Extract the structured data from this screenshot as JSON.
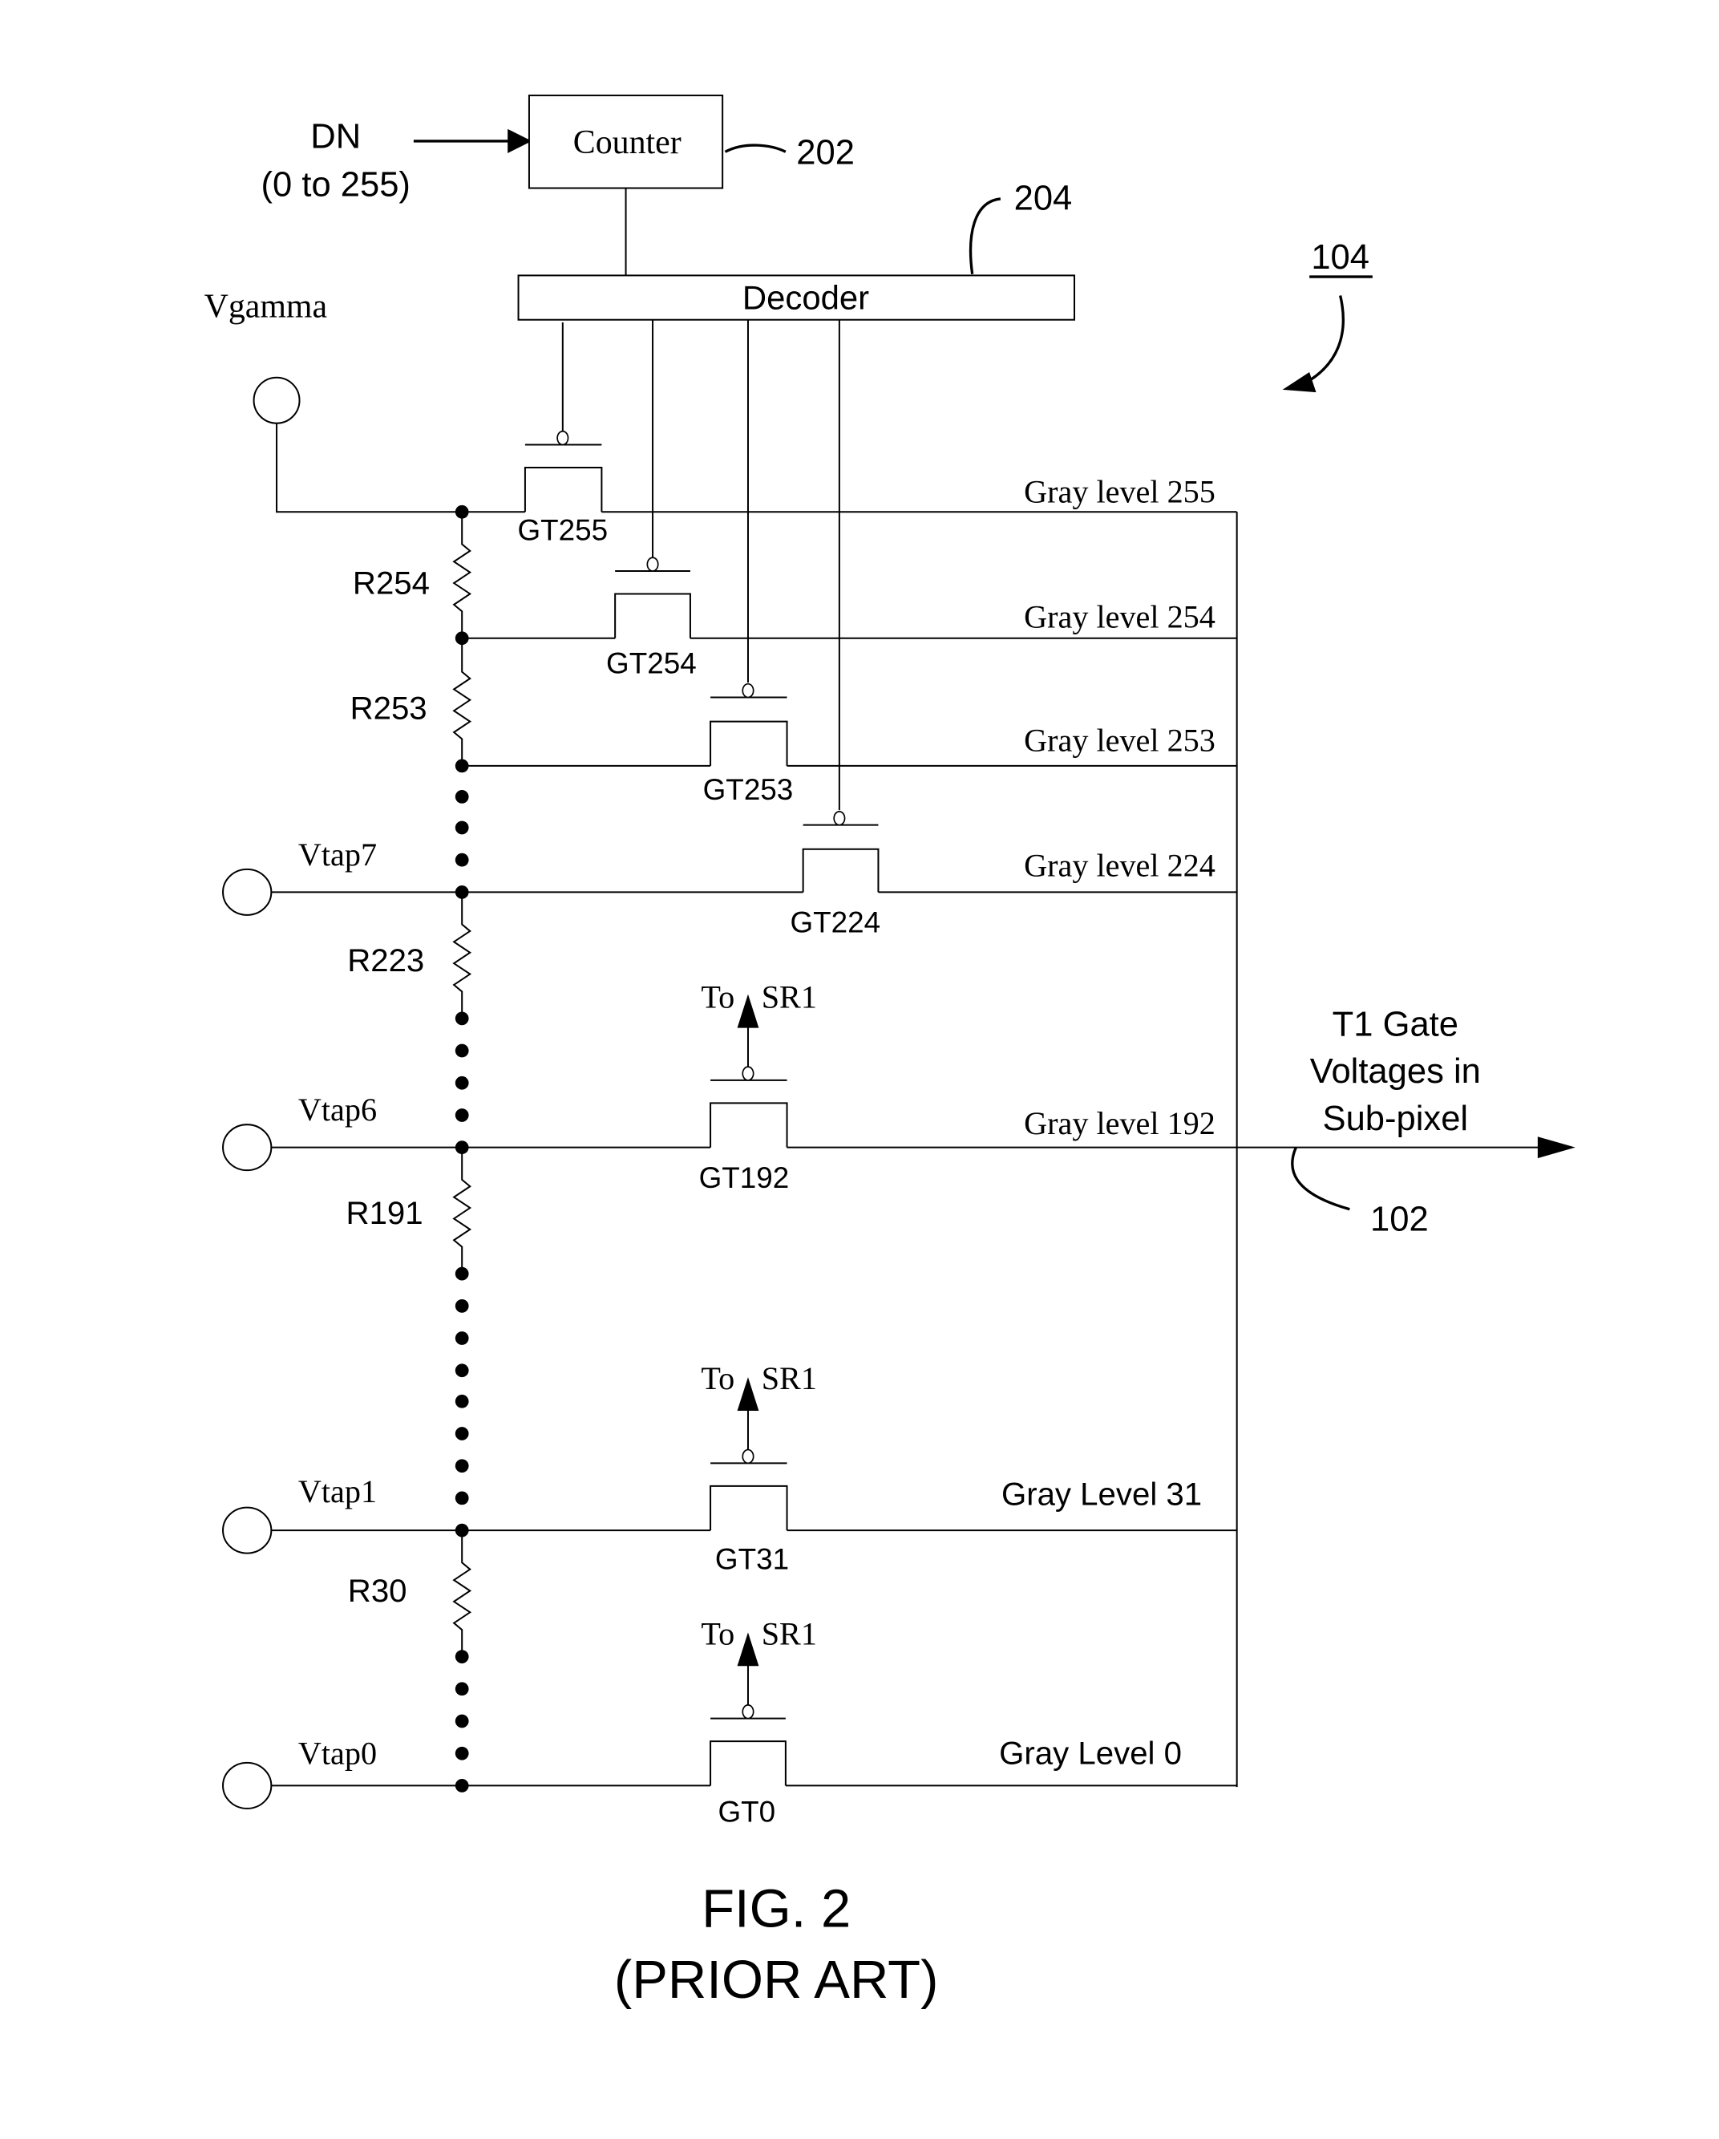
{
  "figure": {
    "title": "FIG. 2",
    "subtitle": "(PRIOR ART)",
    "reference": "104"
  },
  "input": {
    "label": "DN",
    "range": "(0 to 255)"
  },
  "counter": {
    "label": "Counter",
    "ref": "202"
  },
  "decoder": {
    "label": "Decoder",
    "ref": "204"
  },
  "vgamma": {
    "label": "Vgamma"
  },
  "output": {
    "line1": "T1 Gate",
    "line2": "Voltages in",
    "line3": "Sub-pixel",
    "ref": "102"
  },
  "taps": [
    {
      "label": "Vtap7"
    },
    {
      "label": "Vtap6"
    },
    {
      "label": "Vtap1"
    },
    {
      "label": "Vtap0"
    }
  ],
  "resistors": [
    {
      "label": "R254"
    },
    {
      "label": "R253"
    },
    {
      "label": "R223"
    },
    {
      "label": "R191"
    },
    {
      "label": "R30"
    }
  ],
  "transistors": [
    {
      "label": "GT255",
      "gate": "decoder"
    },
    {
      "label": "GT254",
      "gate": "decoder"
    },
    {
      "label": "GT253",
      "gate": "decoder"
    },
    {
      "label": "GT224",
      "gate": "decoder"
    },
    {
      "label": "GT192",
      "gate": "To SR1"
    },
    {
      "label": "GT31",
      "gate": "To SR1"
    },
    {
      "label": "GT0",
      "gate": "To SR1"
    }
  ],
  "gate_labels": {
    "to_sr1_left": "To",
    "to_sr1_right": "SR1"
  },
  "gray_levels": [
    {
      "label": "Gray level 255"
    },
    {
      "label": "Gray level 254"
    },
    {
      "label": "Gray level 253"
    },
    {
      "label": "Gray level 224"
    },
    {
      "label": "Gray level 192"
    },
    {
      "label": "Gray Level 31"
    },
    {
      "label": "Gray Level 0"
    }
  ]
}
